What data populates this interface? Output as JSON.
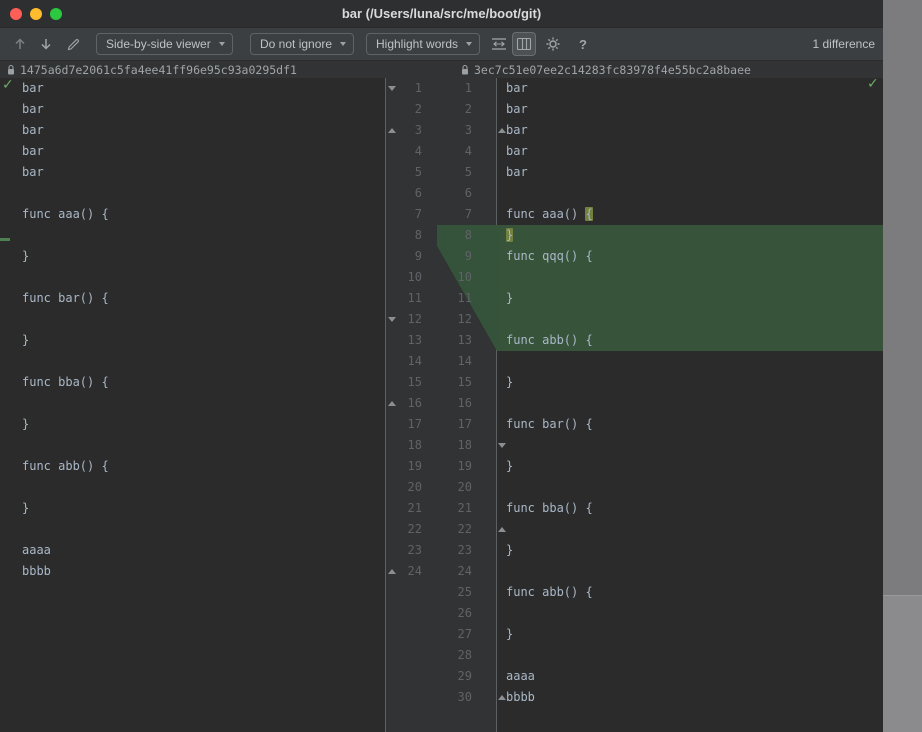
{
  "window": {
    "title": "bar (/Users/luna/src/me/boot/git)",
    "traffic_light_colors": {
      "close": "#ff5f57",
      "minimize": "#febc2e",
      "zoom": "#2bc840"
    }
  },
  "toolbar": {
    "viewer_dropdown": "Side-by-side viewer",
    "ignore_dropdown": "Do not ignore",
    "highlight_dropdown": "Highlight words",
    "help_glyph": "?",
    "difference_count": "1 difference",
    "icons": [
      "up-arrow-icon",
      "down-arrow-icon",
      "pencil-icon",
      "collapse-unchanged-icon",
      "two-columns-icon",
      "gear-icon",
      "help-icon"
    ]
  },
  "revisions": {
    "left_hash": "1475a6d7e2061c5fa4ee41ff96e95c93a0295df1",
    "right_hash": "3ec7c51e07ee2c14283fc83978f4e55bc2a8baee"
  },
  "diff": {
    "left_lines": [
      "bar",
      "bar",
      "bar",
      "bar",
      "bar",
      "",
      "func aaa() {",
      "",
      "}",
      "",
      "func bar() {",
      "",
      "}",
      "",
      "func bba() {",
      "",
      "}",
      "",
      "func abb() {",
      "",
      "}",
      "",
      "aaaa",
      "bbbb"
    ],
    "right_lines": [
      "bar",
      "bar",
      "bar",
      "bar",
      "bar",
      "",
      "func aaa() {",
      "}",
      "func qqq() {",
      "",
      "}",
      "",
      "func abb() {",
      "",
      "}",
      "",
      "func bar() {",
      "",
      "}",
      "",
      "func bba() {",
      "",
      "}",
      "",
      "func abb() {",
      "",
      "}",
      "",
      "aaaa",
      "bbbb"
    ],
    "right_inserted_start": 8,
    "right_inserted_end": 13,
    "word_highlights": [
      {
        "line": 7,
        "prefix": "func aaa() ",
        "text": "{"
      },
      {
        "line": 8,
        "prefix": "",
        "text": "}"
      }
    ],
    "left_fold_markers": [
      {
        "line": 1,
        "dir": "down"
      },
      {
        "line": 3,
        "dir": "up"
      },
      {
        "line": 12,
        "dir": "down"
      },
      {
        "line": 16,
        "dir": "up"
      },
      {
        "line": 24,
        "dir": "up"
      }
    ],
    "right_fold_markers": [
      {
        "line": 3,
        "dir": "up"
      },
      {
        "line": 18,
        "dir": "down"
      },
      {
        "line": 22,
        "dir": "up"
      },
      {
        "line": 30,
        "dir": "up"
      }
    ],
    "colors": {
      "inserted_line_bg": "#37543b",
      "word_highlight_bg": "#72813e",
      "connector_fill": "#35523a",
      "insertion_marker": "#4e8052",
      "applied_check": "#6cab6c"
    }
  }
}
